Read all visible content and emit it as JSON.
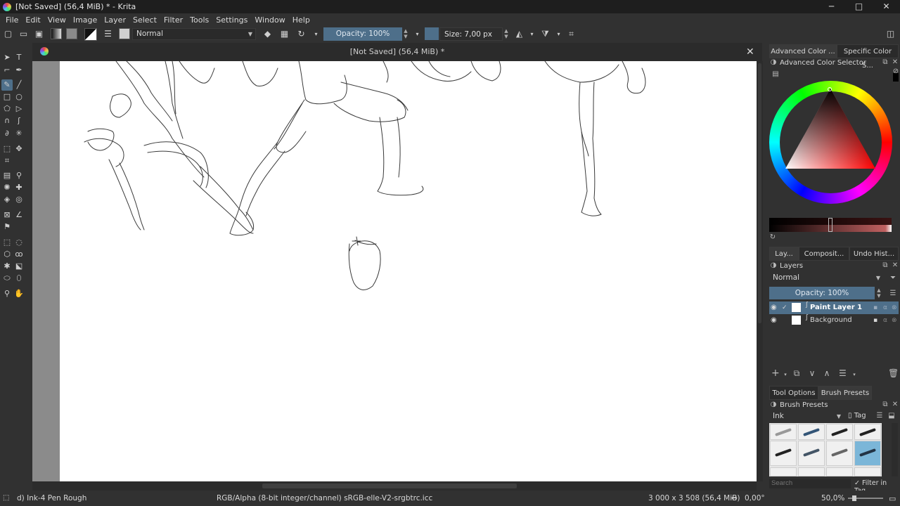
{
  "window": {
    "title": "[Not Saved]  (56,4 MiB) * - Krita",
    "min": "─",
    "max": "□",
    "close": "✕"
  },
  "menu": [
    "File",
    "Edit",
    "View",
    "Image",
    "Layer",
    "Select",
    "Filter",
    "Tools",
    "Settings",
    "Window",
    "Help"
  ],
  "toolbar": {
    "blend_mode": "Normal",
    "opacity_label": "Opacity: 100%",
    "size_label": "Size: 7,00 px"
  },
  "document": {
    "tab_title": "[Not Saved]  (56,4 MiB) *",
    "close": "✕"
  },
  "dock": {
    "color_tabs": [
      "Advanced Color ...",
      "Specific Color S..."
    ],
    "color_panel_title": "Advanced Color Selector",
    "mid_tabs": [
      "Lay...",
      "Composit...",
      "Undo Hist..."
    ],
    "layers_title": "Layers",
    "layers_blend": "Normal",
    "layers_opacity": "Opacity:  100%",
    "layers": [
      {
        "name": "Paint Layer 1",
        "selected": true
      },
      {
        "name": "Background",
        "selected": false
      }
    ],
    "bottom_tabs": [
      "Tool Options",
      "Brush Presets"
    ],
    "presets_title": "Brush Presets",
    "presets_tag": "Ink",
    "tag_button": "Tag",
    "search_placeholder": "Search",
    "filter_in_tag": "Filter in Tag"
  },
  "status": {
    "brush": "d) Ink-4 Pen Rough",
    "color_space": "RGB/Alpha (8-bit integer/channel)  sRGB-elle-V2-srgbtrc.icc",
    "image_size": "3 000 x 3 508 (56,4 MiB)",
    "rotation": "0,00°",
    "zoom": "50,0%"
  },
  "colors": {
    "accent": "#4e6f8a",
    "bg": "#313131"
  }
}
